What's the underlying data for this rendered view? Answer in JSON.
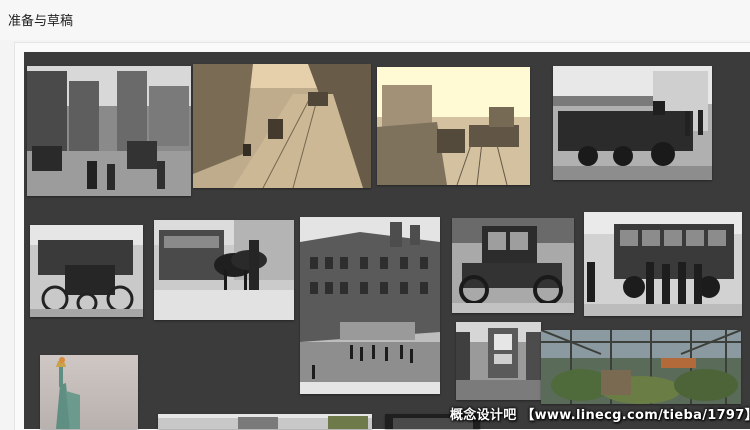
{
  "page": {
    "title": "准备与草稿"
  },
  "board": {
    "photos": [
      {
        "name": "photo-city-street-cars",
        "tone": "grayscale"
      },
      {
        "name": "photo-street-trolley-tracks",
        "tone": "sepia"
      },
      {
        "name": "photo-railway-yard-hillside",
        "tone": "sepia"
      },
      {
        "name": "photo-steam-locomotive-station",
        "tone": "grayscale"
      },
      {
        "name": "photo-early-motor-carriage-group",
        "tone": "grayscale"
      },
      {
        "name": "photo-horse-drawn-streetcar",
        "tone": "grayscale"
      },
      {
        "name": "photo-street-corner-buildings",
        "tone": "grayscale"
      },
      {
        "name": "photo-vintage-automobile",
        "tone": "grayscale"
      },
      {
        "name": "photo-motor-bus-passengers",
        "tone": "grayscale"
      },
      {
        "name": "photo-statue-of-liberty",
        "tone": "color"
      },
      {
        "name": "photo-ruined-theatre-marquee",
        "tone": "grayscale"
      },
      {
        "name": "photo-abandoned-greenhouse",
        "tone": "color"
      }
    ]
  },
  "watermark": {
    "text": "概念设计吧 【www.linecg.com/tieba/1797】"
  }
}
